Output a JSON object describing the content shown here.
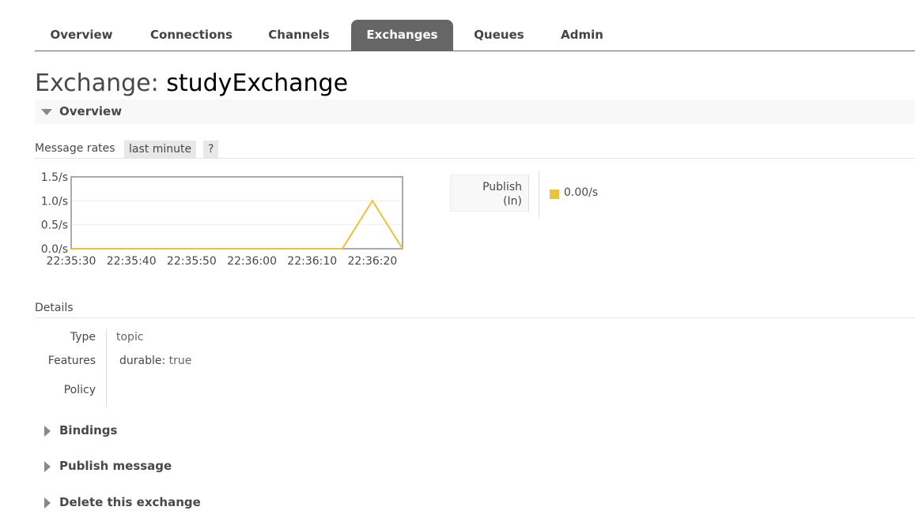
{
  "nav": {
    "tabs": [
      {
        "label": "Overview"
      },
      {
        "label": "Connections"
      },
      {
        "label": "Channels"
      },
      {
        "label": "Exchanges",
        "active": true
      },
      {
        "label": "Queues"
      },
      {
        "label": "Admin"
      }
    ]
  },
  "page": {
    "title_prefix": "Exchange: ",
    "title_name": "studyExchange"
  },
  "overview_section": {
    "label": "Overview",
    "message_rates_label": "Message rates",
    "range_label": "last minute",
    "help_label": "?"
  },
  "chart_data": {
    "type": "line",
    "x": [
      "22:35:30",
      "22:35:40",
      "22:35:50",
      "22:36:00",
      "22:36:10",
      "22:36:15",
      "22:36:20",
      "22:36:25"
    ],
    "series": [
      {
        "name": "Publish (In)",
        "color": "#e8c43c",
        "values": [
          0,
          0,
          0,
          0,
          0,
          0,
          1.0,
          0
        ]
      }
    ],
    "xtick_labels": [
      "22:35:30",
      "22:35:40",
      "22:35:50",
      "22:36:00",
      "22:36:10",
      "22:36:20"
    ],
    "ytick_labels": [
      "0.0/s",
      "0.5/s",
      "1.0/s",
      "1.5/s"
    ],
    "ylim": [
      0,
      1.5
    ],
    "grid": true
  },
  "legend": {
    "key_line1": "Publish",
    "key_line2": "(In)",
    "value": "0.00/s",
    "swatch_color": "#e8c43c"
  },
  "details": {
    "heading": "Details",
    "type_label": "Type",
    "type_value": "topic",
    "features_label": "Features",
    "features_key": "durable:",
    "features_value": "true",
    "policy_label": "Policy"
  },
  "collapsed_sections": {
    "bindings": "Bindings",
    "publish_message": "Publish message",
    "delete_exchange": "Delete this exchange"
  }
}
